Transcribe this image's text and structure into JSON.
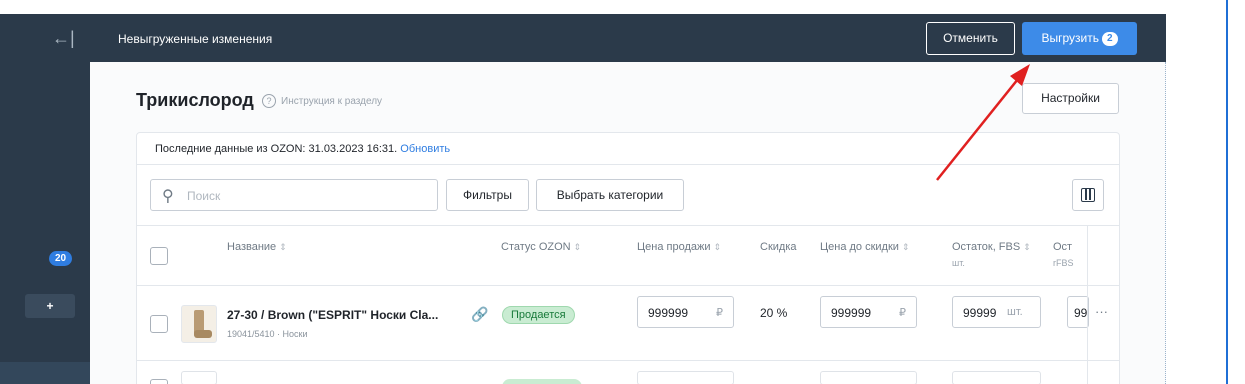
{
  "sidebar": {
    "collapse_icon": "collapse-left-icon",
    "badge_count": "20",
    "add_label": "+"
  },
  "topbar": {
    "title": "Невыгруженные изменения",
    "cancel_label": "Отменить",
    "export_label": "Выгрузить",
    "export_count": "2"
  },
  "page": {
    "title": "Трикислород",
    "help_label": "Инструкция к разделу",
    "settings_label": "Настройки"
  },
  "toolbar": {
    "update_text": "Последние данные из OZON: 31.03.2023 16:31.",
    "update_link": "Обновить",
    "search_placeholder": "Поиск",
    "filters_label": "Фильтры",
    "categories_label": "Выбрать категории"
  },
  "table": {
    "columns": [
      {
        "label": "Название",
        "sort": "⇕"
      },
      {
        "label": "Статус OZON",
        "sort": "⇕"
      },
      {
        "label": "Цена продажи",
        "sort": "⇕"
      },
      {
        "label": "Скидка",
        "sort": ""
      },
      {
        "label": "Цена до скидки",
        "sort": "⇕"
      },
      {
        "label": "Остаток, FBS",
        "sort": "⇕",
        "sub": "шт."
      },
      {
        "label": "Ост",
        "sub": "rFBS"
      }
    ],
    "rows": [
      {
        "name": "27-30 / Brown (\"ESPRIT\" Носки Cla...",
        "sub": "19041/5410 · Носки",
        "status": "Продается",
        "price": "999999",
        "price_unit": "₽",
        "discount": "20 %",
        "price_before": "999999",
        "price_before_unit": "₽",
        "stock": "99999",
        "stock_unit": "шт.",
        "stock_rfbs": "99",
        "more": "···"
      }
    ]
  },
  "colors": {
    "topbar_bg": "#2b3a4a",
    "accent": "#3d8be8",
    "status_green_bg": "#c9ecd2",
    "annotation_arrow": "#e02020"
  }
}
